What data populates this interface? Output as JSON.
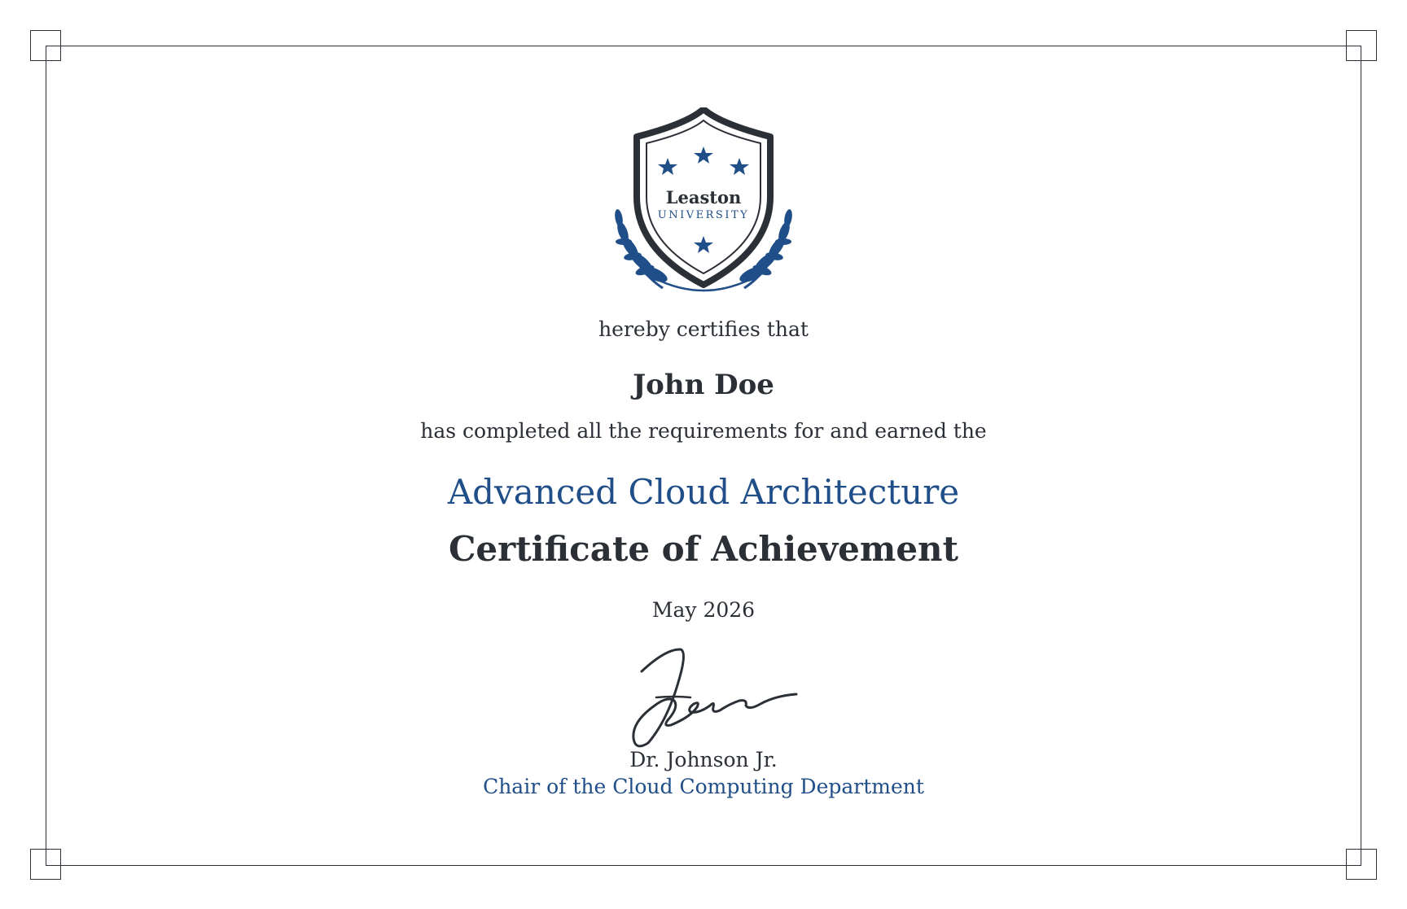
{
  "institution": {
    "name": "Leaston",
    "subname": "UNIVERSITY"
  },
  "certificate": {
    "intro": "hereby certifies that",
    "recipient": "John Doe",
    "statement": "has completed all the requirements for and earned the",
    "program": "Advanced Cloud Architecture",
    "award": "Certificate of Achievement",
    "date": "May 2026"
  },
  "signatory": {
    "name": "Dr. Johnson Jr.",
    "title": "Chair of the Cloud Computing Department"
  },
  "colors": {
    "accent": "#1f4e89",
    "text": "#2b2f36",
    "border": "#2b2f36",
    "background": "#ffffff"
  }
}
